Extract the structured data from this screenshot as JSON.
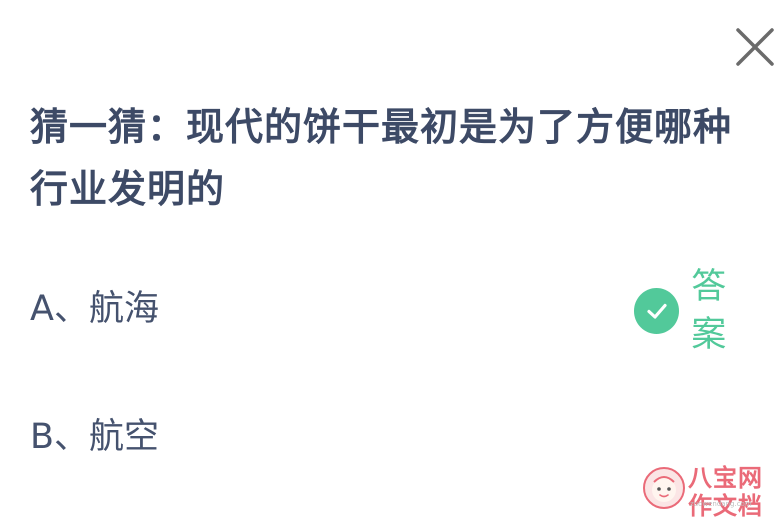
{
  "question": {
    "line1": "猜一猜：现代的饼干最初是为了方便哪种",
    "line2": "行业发明的"
  },
  "options": [
    {
      "label": "A、航海",
      "is_answer": true
    },
    {
      "label": "B、航空",
      "is_answer": false
    }
  ],
  "answer_label": "答案",
  "close_icon": "close-icon",
  "check_icon": "check-icon",
  "colors": {
    "question_text": "#3d4a66",
    "option_text": "#45526e",
    "accent_green": "#52c99a",
    "close_gray": "#6b6b6b",
    "watermark_red": "#e85a6a"
  },
  "watermark": {
    "text": "八宝网 作文档",
    "site": "zuowendang.com"
  }
}
